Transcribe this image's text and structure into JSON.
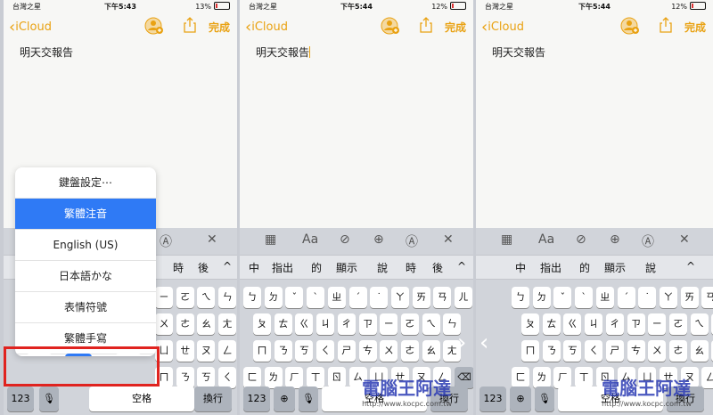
{
  "colors": {
    "accent": "#e9a213",
    "selected": "#2f7af5",
    "highlight": "#e0231f"
  },
  "phones": [
    {
      "carrier": "台灣之星",
      "time": "下午5:43",
      "battery": "13%",
      "back": "iCloud",
      "done": "完成",
      "note": "明天交報告",
      "candidates": [
        "時",
        "後",
        "^"
      ]
    },
    {
      "carrier": "台灣之星",
      "time": "下午5:44",
      "battery": "12%",
      "back": "iCloud",
      "done": "完成",
      "note": "明天交報告",
      "candidates": [
        "中",
        "指出",
        "的",
        "顯示",
        "說",
        "時",
        "後",
        "^"
      ]
    },
    {
      "carrier": "台灣之星",
      "time": "下午5:44",
      "battery": "12%",
      "back": "iCloud",
      "done": "完成",
      "note": "明天交報告",
      "candidates": [
        "中",
        "指出",
        "的",
        "顯示",
        "說",
        "^"
      ]
    }
  ],
  "toolbar_icons": [
    "table-icon",
    "Aa",
    "check-icon",
    "plus-icon",
    "sketch-icon",
    "close-icon"
  ],
  "toolbar_text": "Aa",
  "rows": {
    "r1": [
      "ㄅ",
      "ㄉ",
      "ˇ",
      "ˋ",
      "ㄓ",
      "ˊ",
      "˙",
      "ㄚ",
      "ㄞ",
      "ㄢ",
      "ㄦ"
    ],
    "r2": [
      "ㄆ",
      "ㄊ",
      "ㄍ",
      "ㄐ",
      "ㄔ",
      "ㄗ",
      "ㄧ",
      "ㄛ",
      "ㄟ",
      "ㄣ"
    ],
    "r3": [
      "ㄇ",
      "ㄋ",
      "ㄎ",
      "ㄑ",
      "ㄕ",
      "ㄘ",
      "ㄨ",
      "ㄜ",
      "ㄠ",
      "ㄤ"
    ],
    "r4": [
      "ㄈ",
      "ㄌ",
      "ㄏ",
      "ㄒ",
      "ㄖ",
      "ㄙ",
      "ㄩ",
      "ㄝ",
      "ㄡ",
      "ㄥ"
    ],
    "p1r1": [
      "ㄧ",
      "ㄛ",
      "ㄟ",
      "ㄣ"
    ],
    "p1r2": [
      "ㄨ",
      "ㄜ",
      "ㄠ",
      "ㄤ"
    ],
    "p1r3": [
      "ㄩ",
      "ㄝ",
      "ㄡ",
      "ㄥ"
    ],
    "p1r4": [
      "ㄇ",
      "ㄋ",
      "ㄎ",
      "ㄑ",
      "ㄕ",
      "ㄘ"
    ]
  },
  "bottom": {
    "num": "123",
    "space": "空格",
    "ret": "換行"
  },
  "popup": {
    "items": [
      "鍵盤設定⋯",
      "繁體注音",
      "English (US)",
      "日本語かな",
      "表情符號",
      "繁體手寫"
    ],
    "selected_index": 1
  },
  "watermark": {
    "title": "電腦王阿達",
    "url": "http://www.kocpc.com.tw"
  }
}
